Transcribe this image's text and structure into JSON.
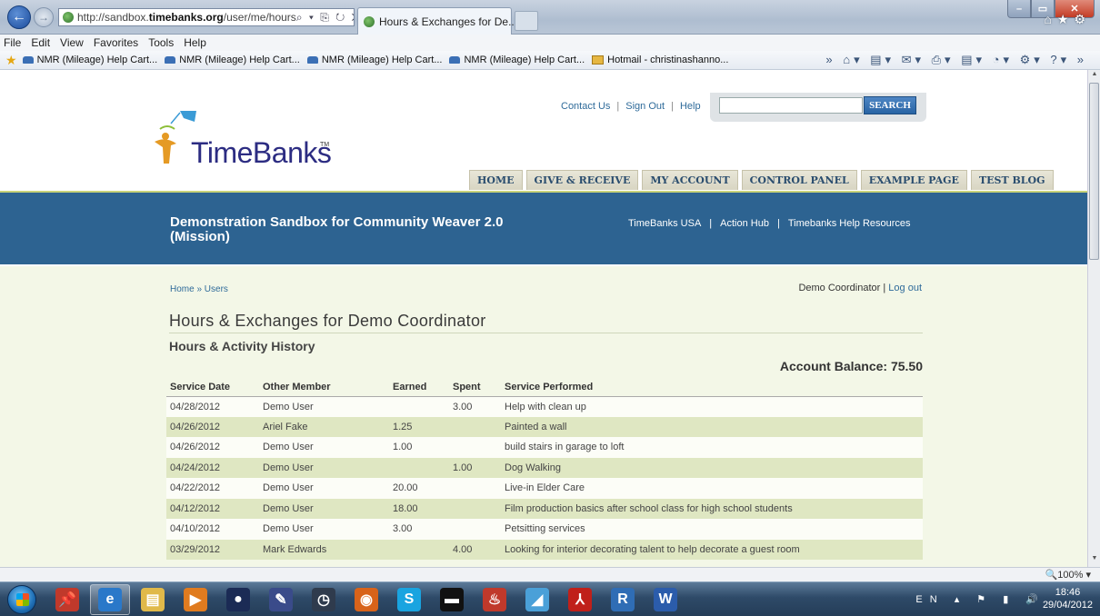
{
  "browser": {
    "url_prefix": "http://sandbox.",
    "url_domain": "timebanks.org",
    "url_path": "/user/me/hours",
    "addr_tools": "⌕ ▾ ⎘ ↻ ✕",
    "tab_title": "Hours & Exchanges for De...",
    "tab_close": "✕",
    "back": "←",
    "forward": "→",
    "min": "–",
    "max": "▭",
    "close": "✕",
    "right_icons": "⌂★⚙",
    "menu": [
      "File",
      "Edit",
      "View",
      "Favorites",
      "Tools",
      "Help"
    ],
    "favorites": [
      {
        "label": "NMR (Mileage) Help Cart...",
        "icon": "car-icon"
      },
      {
        "label": "NMR (Mileage) Help Cart...",
        "icon": "car-icon"
      },
      {
        "label": "NMR (Mileage) Help Cart...",
        "icon": "car-icon"
      },
      {
        "label": "NMR (Mileage) Help Cart...",
        "icon": "car-icon"
      },
      {
        "label": "Hotmail - christinashanno...",
        "icon": "mail-icon"
      }
    ],
    "cmd_icons": "» ⌂▾ ▤▾ ✉▾ ⎙▾ ▤▾ ◔▾ ⚙▾ ?▾ »",
    "zoom": "🔍100% ▾"
  },
  "site": {
    "logo_time": "Time",
    "logo_banks": "Banks",
    "logo_tm": "TM",
    "util_links": [
      "Contact Us",
      "Sign Out",
      "Help"
    ],
    "search_placeholder": "",
    "search_button": "SEARCH",
    "nav": [
      "HOME",
      "GIVE & RECEIVE",
      "MY ACCOUNT",
      "CONTROL PANEL",
      "EXAMPLE PAGE",
      "TEST BLOG"
    ],
    "mission_title": "Demonstration Sandbox for Community Weaver 2.0 (Mission)",
    "band_links": [
      "TimeBanks USA",
      "Action Hub",
      "Timebanks Help Resources"
    ],
    "breadcrumb": "Home » Users",
    "user_name": "Demo Coordinator",
    "user_sep": " | ",
    "logout": "Log out",
    "page_title": "Hours & Exchanges for Demo Coordinator",
    "subtitle": "Hours & Activity History",
    "balance": "Account Balance: 75.50"
  },
  "table": {
    "headers": [
      "Service Date",
      "Other Member",
      "Earned",
      "Spent",
      "Service Performed"
    ],
    "rows": [
      [
        "04/28/2012",
        "Demo User",
        "",
        "3.00",
        "Help with clean up"
      ],
      [
        "04/26/2012",
        "Ariel Fake",
        "1.25",
        "",
        "Painted a wall"
      ],
      [
        "04/26/2012",
        "Demo User",
        "1.00",
        "",
        "build stairs in garage to loft"
      ],
      [
        "04/24/2012",
        "Demo User",
        "",
        "1.00",
        "Dog Walking"
      ],
      [
        "04/22/2012",
        "Demo User",
        "20.00",
        "",
        "Live-in Elder Care"
      ],
      [
        "04/12/2012",
        "Demo User",
        "18.00",
        "",
        "Film production basics after school class for high school students"
      ],
      [
        "04/10/2012",
        "Demo User",
        "3.00",
        "",
        "Petsitting services"
      ],
      [
        "03/29/2012",
        "Mark Edwards",
        "",
        "4.00",
        "Looking for interior decorating talent to help decorate a guest room"
      ]
    ]
  },
  "taskbar": {
    "tray": "EN ▴ ⚑ ▮ 🔊",
    "time": "18:46",
    "date": "29/04/2012",
    "apps": [
      {
        "name": "pin-app-icon",
        "glyph": "📌",
        "color": "#c0392b",
        "active": false
      },
      {
        "name": "internet-explorer-icon",
        "glyph": "e",
        "color": "#2a78c9",
        "active": true
      },
      {
        "name": "file-explorer-icon",
        "glyph": "▤",
        "color": "#e0b94a",
        "active": false
      },
      {
        "name": "media-player-icon",
        "glyph": "▶",
        "color": "#e07b1f",
        "active": false
      },
      {
        "name": "user-app-icon",
        "glyph": "●",
        "color": "#1b2b55",
        "active": false
      },
      {
        "name": "pen-app-icon",
        "glyph": "✎",
        "color": "#3a4b8a",
        "active": false
      },
      {
        "name": "clock-app-icon",
        "glyph": "◷",
        "color": "#2f3b4d",
        "active": false
      },
      {
        "name": "firefox-icon",
        "glyph": "◉",
        "color": "#d8631a",
        "active": false
      },
      {
        "name": "skype-icon",
        "glyph": "S",
        "color": "#19a4e0",
        "active": false
      },
      {
        "name": "terminal-icon",
        "glyph": "▬",
        "color": "#111",
        "active": false
      },
      {
        "name": "java-icon",
        "glyph": "♨",
        "color": "#c0392b",
        "active": false
      },
      {
        "name": "app-icon",
        "glyph": "◢",
        "color": "#4aa0d8",
        "active": false
      },
      {
        "name": "acrobat-icon",
        "glyph": "⅄",
        "color": "#c0201a",
        "active": false
      },
      {
        "name": "r-app-icon",
        "glyph": "R",
        "color": "#2f6db5",
        "active": false
      },
      {
        "name": "word-icon",
        "glyph": "W",
        "color": "#2b5cab",
        "active": false
      }
    ]
  }
}
